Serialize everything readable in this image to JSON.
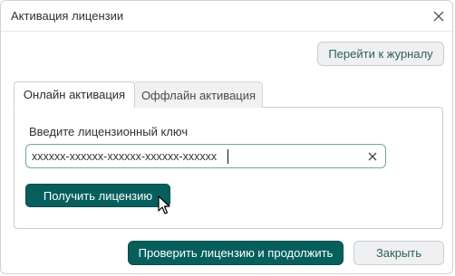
{
  "dialog": {
    "title": "Активация лицензии",
    "close_icon": "close-icon",
    "journal_button": "Перейти к журналу"
  },
  "tabs": [
    {
      "label": "Онлайн активация",
      "active": true
    },
    {
      "label": "Оффлайн активация",
      "active": false
    }
  ],
  "online": {
    "field_label": "Введите лицензионный ключ",
    "key_value": "xxxxxx-xxxxxx-xxxxxx-xxxxxx-xxxxxx",
    "clear_icon": "clear-icon",
    "get_license_button": "Получить лицензию"
  },
  "footer": {
    "verify_button": "Проверить лицензию и продолжить",
    "close_button": "Закрыть"
  },
  "colors": {
    "primary": "#065f5d",
    "secondary_bg": "#eef0f1",
    "input_border": "#6ea7a3"
  }
}
